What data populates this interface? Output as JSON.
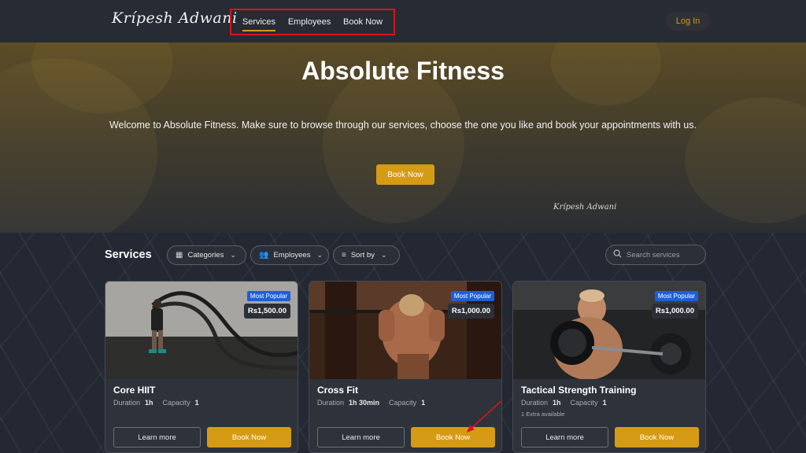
{
  "header": {
    "logo_text": "Krípesh Adwani",
    "nav": [
      "Services",
      "Employees",
      "Book Now"
    ],
    "active_nav": "Services",
    "login_label": "Log In"
  },
  "hero": {
    "title": "Absolute Fitness",
    "subtitle": "Welcome to Absolute Fitness. Make sure to browse through our services, choose the one you like and book your appointments with us.",
    "cta_label": "Book Now",
    "signature": "Krípesh Adwani"
  },
  "services": {
    "heading": "Services",
    "filters": [
      {
        "label": "Categories",
        "icon": "grid-icon"
      },
      {
        "label": "Employees",
        "icon": "users-icon"
      },
      {
        "label": "Sort by",
        "icon": "sort-icon"
      }
    ],
    "search_placeholder": "Search services",
    "cards": [
      {
        "title": "Core HIIT",
        "badge": "Most Popular",
        "price": "Rs1,500.00",
        "duration_label": "Duration",
        "duration": "1h",
        "capacity_label": "Capacity",
        "capacity": "1",
        "extra": "",
        "learn_label": "Learn more",
        "book_label": "Book Now"
      },
      {
        "title": "Cross Fit",
        "badge": "Most Popular",
        "price": "Rs1,000.00",
        "duration_label": "Duration",
        "duration": "1h 30min",
        "capacity_label": "Capacity",
        "capacity": "1",
        "extra": "",
        "learn_label": "Learn more",
        "book_label": "Book Now"
      },
      {
        "title": "Tactical Strength Training",
        "badge": "Most Popular",
        "price": "Rs1,000.00",
        "duration_label": "Duration",
        "duration": "1h",
        "capacity_label": "Capacity",
        "capacity": "1",
        "extra": "1 Extra available",
        "learn_label": "Learn more",
        "book_label": "Book Now"
      }
    ]
  },
  "colors": {
    "accent": "#d59b14",
    "badge": "#1d5fd6",
    "highlight_box": "#d8141c"
  }
}
